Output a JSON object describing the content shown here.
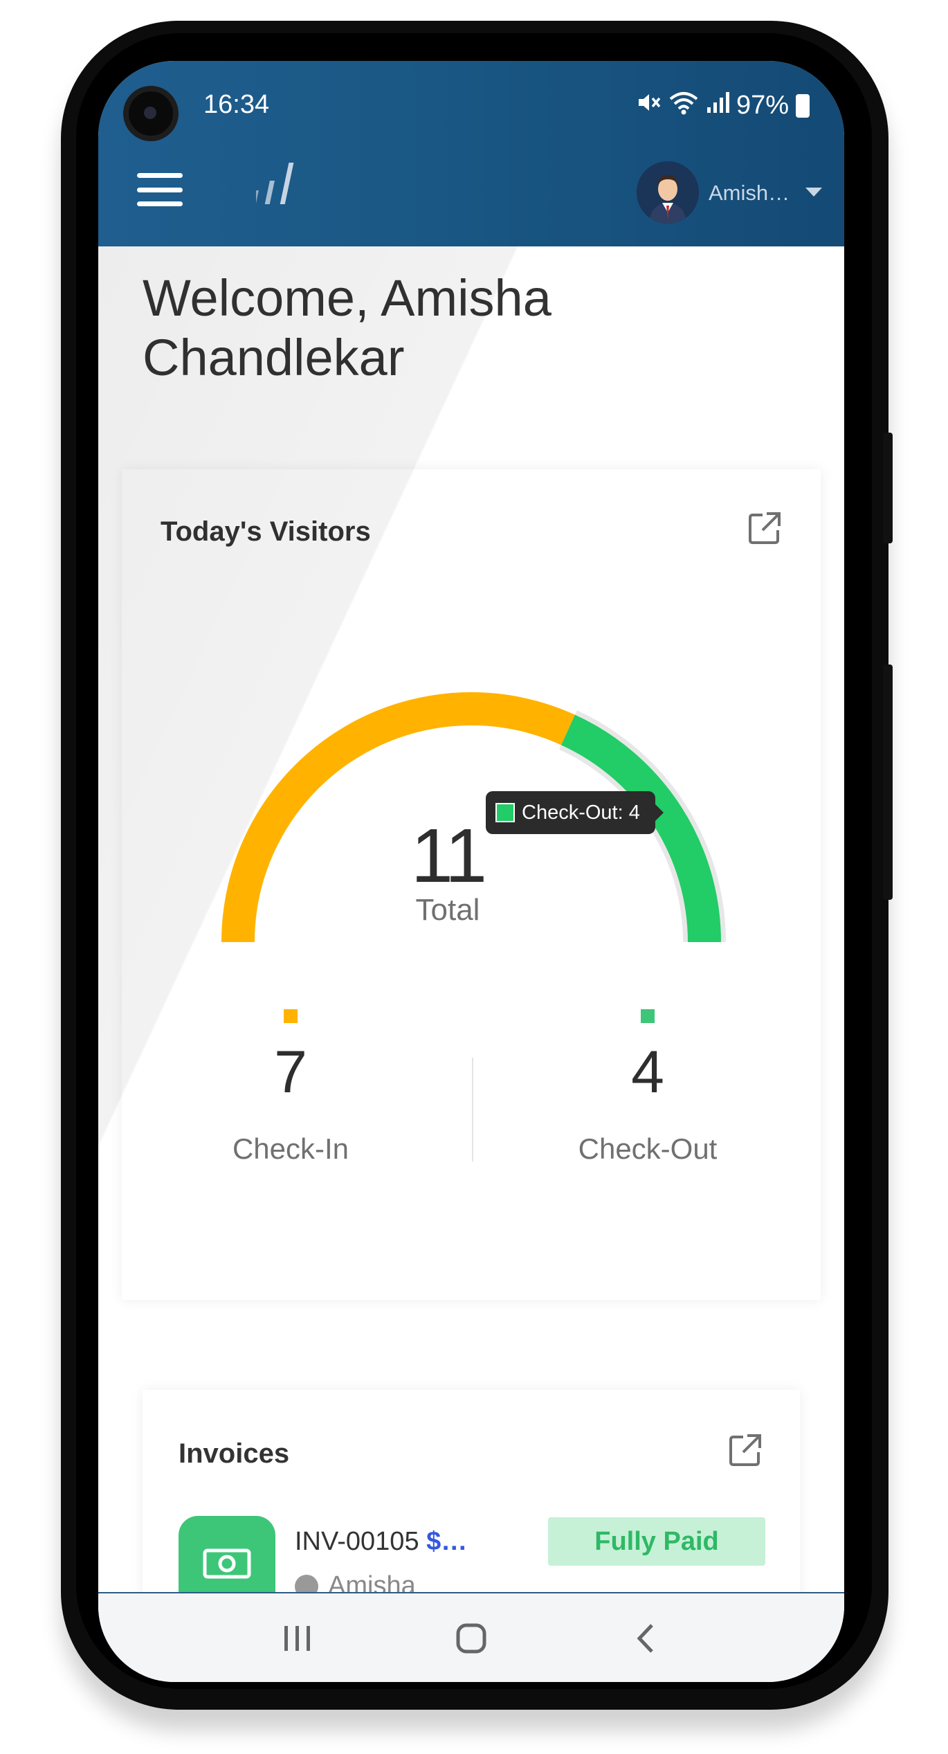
{
  "status_bar": {
    "time": "16:34",
    "battery": "97%",
    "icons": [
      "mute-icon",
      "wifi-icon",
      "signal-icon",
      "battery-charging-icon"
    ]
  },
  "header": {
    "user_name": "Amish…",
    "icons": [
      "hamburger-menu-icon",
      "app-logo-icon",
      "user-avatar",
      "caret-down-icon"
    ],
    "color": "#1a5784"
  },
  "welcome": {
    "line1": "Welcome, Amisha",
    "line2": "Chandlekar"
  },
  "visitors": {
    "title": "Today's Visitors",
    "total": "11",
    "total_label": "Total",
    "tooltip": "Check-Out: 4",
    "check_in": {
      "value": "7",
      "label": "Check-In",
      "color": "#ffb300"
    },
    "check_out": {
      "value": "4",
      "label": "Check-Out",
      "color": "#22cc66"
    }
  },
  "invoices": {
    "title": "Invoices",
    "items": [
      {
        "number": "INV-00105",
        "amount": "$…",
        "client": "Amisha",
        "status": "Fully Paid"
      }
    ]
  },
  "nav": {
    "icons": [
      "recent-apps-icon",
      "home-icon",
      "back-icon"
    ]
  }
}
